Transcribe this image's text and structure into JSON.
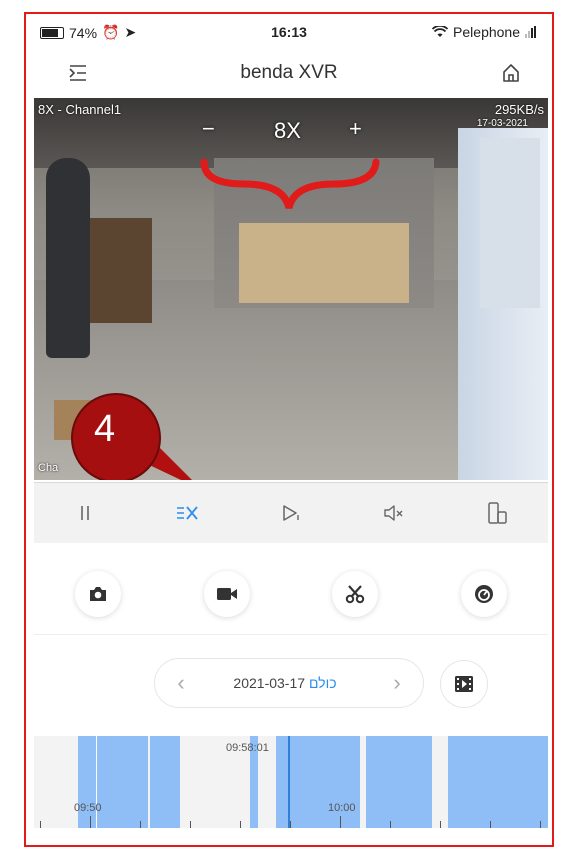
{
  "status_bar": {
    "battery": "74%",
    "time": "16:13",
    "carrier": "Pelephone"
  },
  "nav": {
    "title": "benda XVR",
    "menu_icon": "menu-collapse-icon",
    "home_icon": "home-icon"
  },
  "video": {
    "channel_label": "8X - Channel1",
    "bitrate": "295KB/s",
    "timestamp": "17-03-2021",
    "zoom_level": "8X",
    "zoom_out": "−",
    "zoom_in": "+",
    "bottom_label": "Cha",
    "callout_number": "4",
    "annotation_color": "#e11a1a"
  },
  "controls": [
    {
      "name": "pause",
      "icon": "pause-icon"
    },
    {
      "name": "zoom",
      "icon": "zoom-x-icon",
      "active": true
    },
    {
      "name": "play-step",
      "icon": "play-step-icon"
    },
    {
      "name": "mute",
      "icon": "speaker-mute-icon"
    },
    {
      "name": "device",
      "icon": "device-icon"
    }
  ],
  "actions": [
    {
      "name": "snapshot",
      "icon": "camera-icon"
    },
    {
      "name": "record",
      "icon": "video-record-icon"
    },
    {
      "name": "clip",
      "icon": "scissors-icon"
    },
    {
      "name": "playback-speed",
      "icon": "speed-icon"
    }
  ],
  "date_selector": {
    "today_label": "כולם",
    "date": "2021-03-17",
    "prev": "‹",
    "next": "›"
  },
  "timeline": {
    "current_time": "09:58:01",
    "tick_labels": [
      "09:50",
      "10:00"
    ],
    "accent": "#2d7fd8",
    "segment_color": "#8ebef5"
  }
}
